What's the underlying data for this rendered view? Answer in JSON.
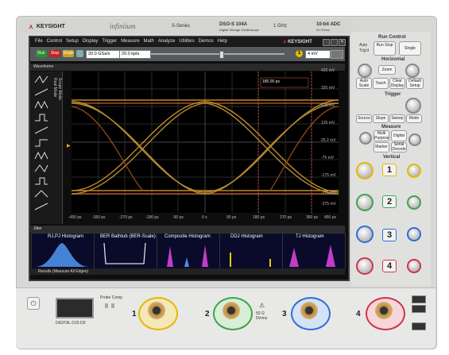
{
  "header": {
    "brand": "KEYSIGHT",
    "model_family": "infiniium",
    "series": "S-Series",
    "model": "DSO-S 104A",
    "model_sub": "Digital Storage Oscilloscope",
    "bandwidth": "1 GHz",
    "adc": "10-bit ADC",
    "sample_rate_label": "20 GSa/s"
  },
  "menu": [
    "File",
    "Control",
    "Setup",
    "Display",
    "Trigger",
    "Measure",
    "Math",
    "Analyze",
    "Utilities",
    "Demos",
    "Help"
  ],
  "screen_logo": "KEYSIGHT",
  "toolbar": {
    "run_label": "Run",
    "stop_label": "Stop",
    "single_label": "Single",
    "sample_rate": "20.0 GSa/s",
    "memory": "20.0 kpts",
    "trigger_level": "4 mV",
    "trigger_badge": "1"
  },
  "wave_strip_label": "Waveforms",
  "sidebar_labels": [
    "Real Mode",
    "Scope Mode"
  ],
  "plot": {
    "marker_delta": "180.00 ps",
    "y_labels": [
      "425 mV",
      "325 mV",
      "225 mV",
      "125 mV",
      "25.2 mV",
      "-75 mV",
      "-175 mV",
      "-275 mV",
      "-375 mV"
    ],
    "x_labels": [
      "-450 ps",
      "-360 ps",
      "-270 ps",
      "-180 ps",
      "-90 ps",
      "0 s",
      "90 ps",
      "180 ps",
      "270 ps",
      "360 ps",
      "450 ps"
    ]
  },
  "jitter_bar_label": "Jitter",
  "panes": [
    {
      "title": "RJ,PJ Histogram"
    },
    {
      "title": "BER Bathtub (BER-Scale)"
    },
    {
      "title": "Composite Histogram"
    },
    {
      "title": "DDJ Histogram"
    },
    {
      "title": "TJ Histogram"
    }
  ],
  "results_bar": "Results  (Measure All Edges)",
  "right_panel": {
    "run_control_title": "Run Control",
    "run_stop": "Run Stop",
    "single": "Single",
    "auto_label": "Auto",
    "trig_label": "Trig'd",
    "horizontal_title": "Horizontal",
    "zoom": "Zoom",
    "auto_scale": "Auto Scale",
    "touch": "Touch",
    "clear_display": "Clear Display",
    "default_setup": "Default Setup",
    "trigger_title": "Trigger",
    "source": "Source",
    "slope": "Slope",
    "sweep": "Sweep",
    "mode": "Mode",
    "measure_title": "Measure",
    "multipurpose": "Multi Purpose",
    "marker": "Marker",
    "digital": "Digital",
    "serial": "Serial Decode",
    "vertical_title": "Vertical",
    "channels": [
      "1",
      "2",
      "3",
      "4"
    ]
  },
  "bottom": {
    "digital_label": "DIGITAL D15-D0",
    "probe_comp": "Probe Comp",
    "channel_nums": [
      "1",
      "2",
      "3",
      "4"
    ],
    "warn_text": "50 Ω\n5Vrms"
  },
  "colors": {
    "ch1": "#e6b800",
    "ch2": "#3fa34d",
    "ch3": "#2f6fd6",
    "ch4": "#d1344a",
    "eye": "#e0a030",
    "pane_blue": "#4b8fe8",
    "pane_magenta": "#c23cc8"
  }
}
